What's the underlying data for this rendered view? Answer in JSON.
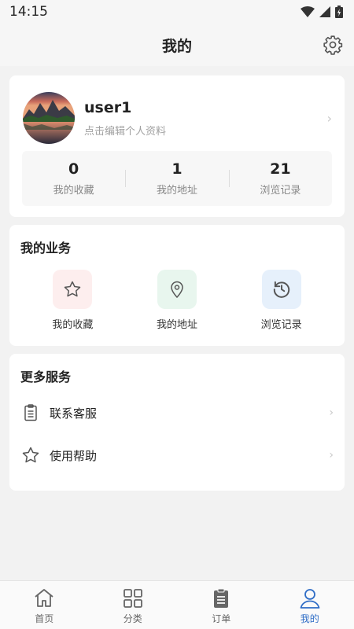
{
  "status_bar": {
    "time": "14:15"
  },
  "header": {
    "title": "我的"
  },
  "profile": {
    "username": "user1",
    "edit_hint": "点击编辑个人资料",
    "stats": [
      {
        "value": "0",
        "label": "我的收藏"
      },
      {
        "value": "1",
        "label": "我的地址"
      },
      {
        "value": "21",
        "label": "浏览记录"
      }
    ]
  },
  "business": {
    "title": "我的业务",
    "items": [
      {
        "label": "我的收藏",
        "icon": "star-icon",
        "bg": "#fdeeee"
      },
      {
        "label": "我的地址",
        "icon": "location-pin-icon",
        "bg": "#e8f6ee"
      },
      {
        "label": "浏览记录",
        "icon": "history-icon",
        "bg": "#e6f0fb"
      }
    ]
  },
  "more_services": {
    "title": "更多服务",
    "items": [
      {
        "label": "联系客服",
        "icon": "clipboard-icon"
      },
      {
        "label": "使用帮助",
        "icon": "star-outline-icon"
      }
    ]
  },
  "tab_bar": {
    "tabs": [
      {
        "label": "首页",
        "icon": "home-icon"
      },
      {
        "label": "分类",
        "icon": "grid-icon"
      },
      {
        "label": "订单",
        "icon": "order-icon"
      },
      {
        "label": "我的",
        "icon": "user-icon",
        "active": true
      }
    ],
    "active_color": "#2f6dc6"
  }
}
